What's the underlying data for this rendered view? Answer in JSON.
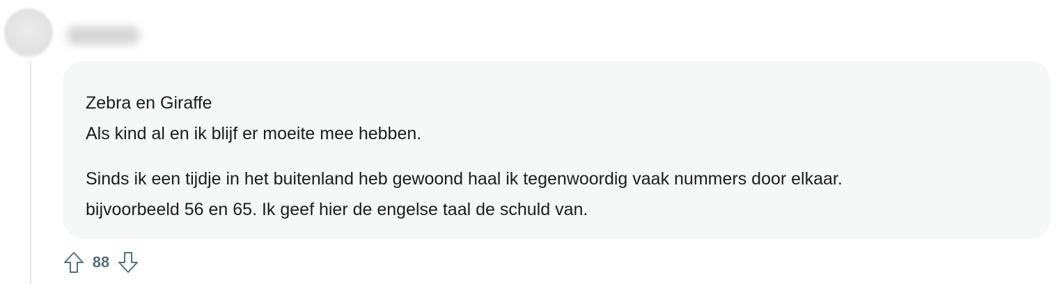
{
  "comment": {
    "author": "",
    "body": {
      "line1": "Zebra en Giraffe",
      "line2": "Als kind al en ik blijf er moeite mee hebben.",
      "line3": "Sinds ik een tijdje in het buitenland heb gewoond haal ik tegenwoordig vaak nummers door elkaar.",
      "line4": "bijvoorbeeld 56 en 65. Ik geef hier de engelse taal de schuld van."
    },
    "score": "88",
    "icons": {
      "upvote": "arrow-up-outline-icon",
      "downvote": "arrow-down-outline-icon"
    },
    "colors": {
      "bubble_bg": "#f6f7f7",
      "vote_color": "#576f76"
    }
  }
}
